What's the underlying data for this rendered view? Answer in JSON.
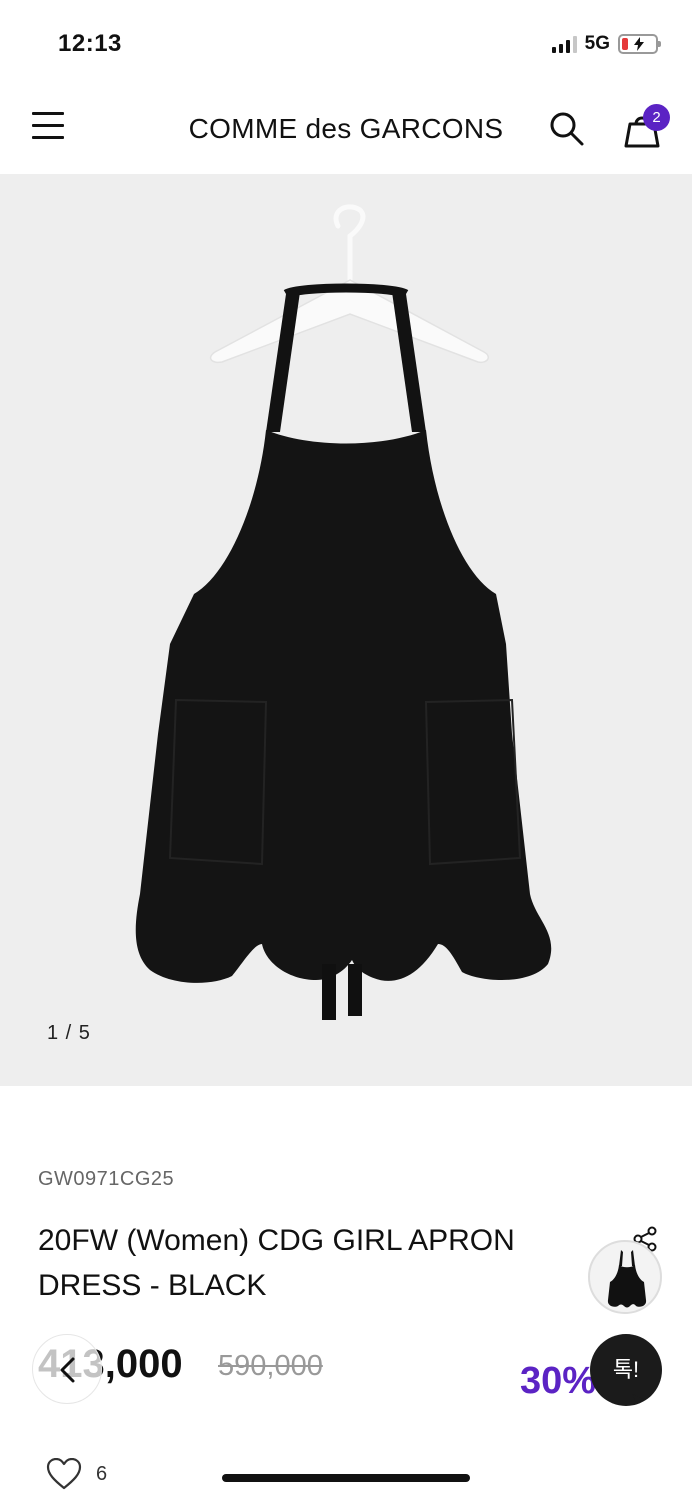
{
  "status_bar": {
    "time": "12:13",
    "network": "5G"
  },
  "header": {
    "brand": "COMME des GARCONS",
    "cart_count": "2"
  },
  "gallery": {
    "current": "1",
    "total": "5",
    "counter": "1 / 5"
  },
  "product": {
    "sku": "GW0971CG25",
    "title": "20FW (Women) CDG GIRL APRON DRESS - BLACK",
    "price": "413,000",
    "original_price": "590,000",
    "discount": "30%",
    "like_count": "6"
  },
  "floating": {
    "talk_label": "톡!"
  },
  "colors": {
    "accent": "#5b23c4",
    "image_bg": "#eeeeee"
  },
  "icons": [
    "menu-icon",
    "search-icon",
    "cart-icon",
    "share-icon",
    "back-chevron-icon",
    "heart-icon"
  ]
}
